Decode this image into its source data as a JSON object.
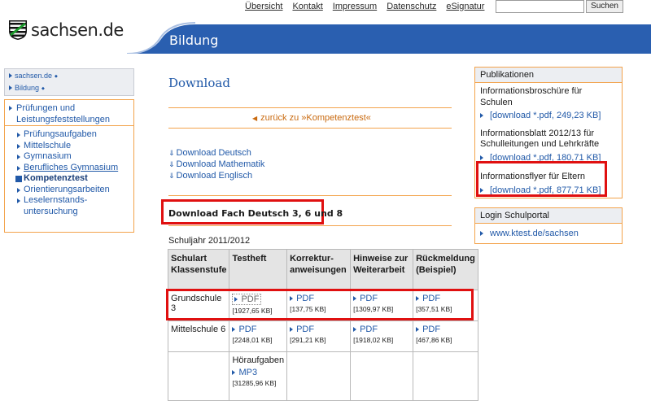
{
  "header": {
    "nav": [
      "Übersicht",
      "Kontakt",
      "Impressum",
      "Datenschutz",
      "eSignatur"
    ],
    "search_placeholder": "",
    "search_button": "Suchen",
    "logo_text": "sachsen.de",
    "banner_title": "Bildung",
    "colors": {
      "banner": "#2a5fb0",
      "accent": "#f3a34b",
      "link": "#2159a8",
      "highlight": "#e01010"
    }
  },
  "left": {
    "breadcrumbs": [
      "sachsen.de",
      "Bildung"
    ],
    "section": "Prüfungen und Leistungsfeststellungen",
    "items": [
      {
        "label": "Prüfungsaufgaben"
      },
      {
        "label": "Mittelschule"
      },
      {
        "label": "Gymnasium"
      },
      {
        "label": "Berufliches Gymnasium"
      },
      {
        "label": "Kompetenztest"
      },
      {
        "label": "Orientierungsarbeiten"
      },
      {
        "label": "Leselernstands-untersuchung"
      }
    ]
  },
  "main": {
    "title": "Download",
    "back_link": "zurück zu »Kompetenztest«",
    "downloads": [
      "Download Deutsch",
      "Download Mathematik",
      "Download Englisch"
    ],
    "section_heading": "Download Fach Deutsch 3, 6 und 8",
    "school_year": "Schuljahr 2011/2012",
    "table": {
      "headers": [
        "Schulart Klassenstufe",
        "Testheft",
        "Korrektur-anweisungen",
        "Hinweise zur Weiterarbeit",
        "Rückmeldung (Beispiel)"
      ],
      "rows": [
        {
          "school": "Grundschule 3",
          "cells": [
            {
              "label": "PDF",
              "size": "[1927,65 KB]"
            },
            {
              "label": "PDF",
              "size": "[137,75 KB]"
            },
            {
              "label": "PDF",
              "size": "[1309,97 KB]"
            },
            {
              "label": "PDF",
              "size": "[357,51 KB]"
            }
          ]
        },
        {
          "school": "Mittelschule 6",
          "cells": [
            {
              "label": "PDF",
              "size": "[2248,01 KB]"
            },
            {
              "label": "PDF",
              "size": "[291,21 KB]"
            },
            {
              "label": "PDF",
              "size": "[1918,02 KB]"
            },
            {
              "label": "PDF",
              "size": "[467,86 KB]"
            }
          ]
        },
        {
          "school": "",
          "extra_title": "Höraufgaben",
          "extra_label": "MP3",
          "extra_size": "[31285,96 KB]"
        }
      ]
    }
  },
  "right": {
    "pub_title": "Publikationen",
    "publications": [
      {
        "title": "Informationsbroschüre für Schulen",
        "link": "[download *.pdf, 249,23 KB]"
      },
      {
        "title": "Informationsblatt 2012/13 für Schulleitungen und Lehrkräfte",
        "link": "[download *.pdf, 180,71 KB]"
      },
      {
        "title": "Informationsflyer für Eltern",
        "link": "[download *.pdf, 877,71 KB]"
      }
    ],
    "login_title": "Login Schulportal",
    "login_link": "www.ktest.de/sachsen"
  }
}
